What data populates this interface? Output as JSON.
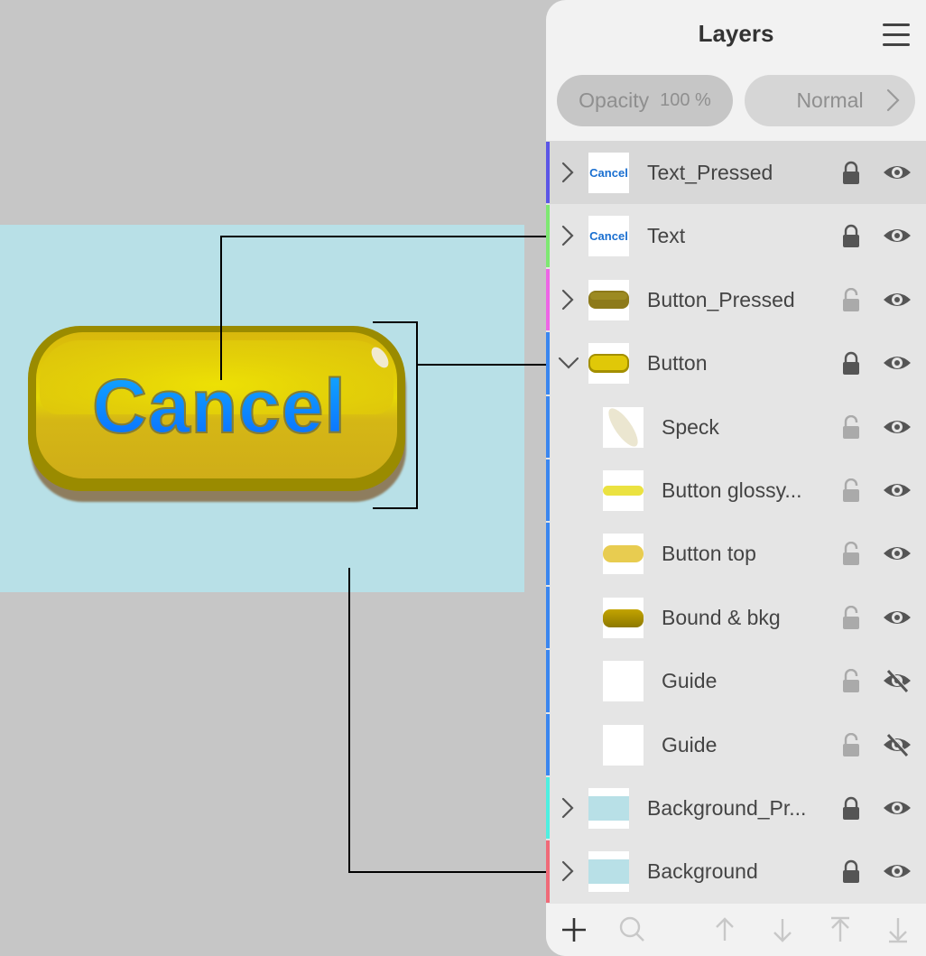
{
  "canvas": {
    "artboard_color": "#b8e0e7",
    "button_label": "Cancel"
  },
  "panel": {
    "title": "Layers",
    "menu_icon": "hamburger-menu-icon",
    "opacity_label": "Opacity",
    "opacity_value": "100 %",
    "blend_mode": "Normal"
  },
  "layers": [
    {
      "name": "Text_Pressed",
      "level": 0,
      "expander": "collapsed",
      "strip_color": "#5b55e6",
      "thumb": "text",
      "locked": true,
      "visible": true,
      "selected": true
    },
    {
      "name": "Text",
      "level": 0,
      "expander": "collapsed",
      "strip_color": "#7ee872",
      "thumb": "text",
      "locked": true,
      "visible": true,
      "selected": false
    },
    {
      "name": "Button_Pressed",
      "level": 0,
      "expander": "collapsed",
      "strip_color": "#ee66e6",
      "thumb": "button-pressed",
      "locked": false,
      "visible": true,
      "selected": false
    },
    {
      "name": "Button",
      "level": 0,
      "expander": "expanded",
      "strip_color": "#3a86f0",
      "thumb": "button",
      "locked": true,
      "visible": true,
      "selected": false
    },
    {
      "name": "Speck",
      "level": 1,
      "expander": "none",
      "strip_color": "#3a86f0",
      "thumb": "speck",
      "locked": false,
      "visible": true,
      "selected": false
    },
    {
      "name": "Button glossy...",
      "level": 1,
      "expander": "none",
      "strip_color": "#3a86f0",
      "thumb": "glossy",
      "locked": false,
      "visible": true,
      "selected": false
    },
    {
      "name": "Button top",
      "level": 1,
      "expander": "none",
      "strip_color": "#3a86f0",
      "thumb": "top",
      "locked": false,
      "visible": true,
      "selected": false
    },
    {
      "name": "Bound & bkg",
      "level": 1,
      "expander": "none",
      "strip_color": "#3a86f0",
      "thumb": "bound",
      "locked": false,
      "visible": true,
      "selected": false
    },
    {
      "name": "Guide",
      "level": 1,
      "expander": "none",
      "strip_color": "#3a86f0",
      "thumb": "blank",
      "locked": false,
      "visible": false,
      "selected": false
    },
    {
      "name": "Guide",
      "level": 1,
      "expander": "none",
      "strip_color": "#3a86f0",
      "thumb": "blank",
      "locked": false,
      "visible": false,
      "selected": false
    },
    {
      "name": "Background_Pr...",
      "level": 0,
      "expander": "collapsed",
      "strip_color": "#4ef0e0",
      "thumb": "background",
      "locked": true,
      "visible": true,
      "selected": false
    },
    {
      "name": "Background",
      "level": 0,
      "expander": "collapsed",
      "strip_color": "#f06a78",
      "thumb": "background",
      "locked": true,
      "visible": true,
      "selected": false
    }
  ],
  "toolbar": [
    {
      "name": "add-layer-button",
      "icon": "plus-icon",
      "enabled": true
    },
    {
      "name": "search-button",
      "icon": "search-icon",
      "enabled": false
    },
    {
      "name": "move-up-button",
      "icon": "arrow-up-icon",
      "enabled": false
    },
    {
      "name": "move-down-button",
      "icon": "arrow-down-icon",
      "enabled": false
    },
    {
      "name": "move-to-top-button",
      "icon": "arrow-to-top-icon",
      "enabled": false
    },
    {
      "name": "move-to-bottom-button",
      "icon": "arrow-to-bottom-icon",
      "enabled": false
    }
  ]
}
